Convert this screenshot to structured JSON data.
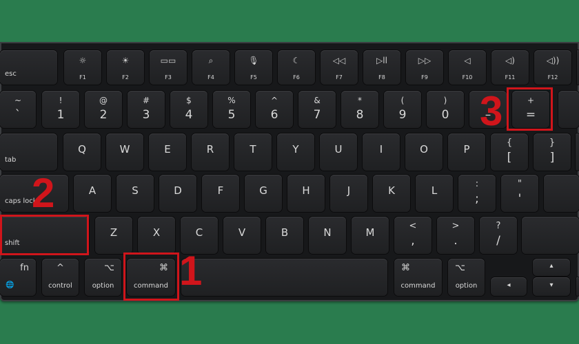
{
  "colors": {
    "background": "#2a7c4e",
    "keyboard": "#17181a",
    "key": "#25262a",
    "annotation": "#d0151b"
  },
  "rows": {
    "function": [
      {
        "main": "esc"
      },
      {
        "icon": "☼",
        "fn": "F1",
        "icon_name": "brightness-down-icon"
      },
      {
        "icon": "☀",
        "fn": "F2",
        "icon_name": "brightness-up-icon"
      },
      {
        "icon": "▭▭",
        "fn": "F3",
        "icon_name": "mission-control-icon"
      },
      {
        "icon": "⌕",
        "fn": "F4",
        "icon_name": "search-icon"
      },
      {
        "icon": "🎙",
        "fn": "F5",
        "icon_name": "microphone-icon"
      },
      {
        "icon": "☾",
        "fn": "F6",
        "icon_name": "moon-icon"
      },
      {
        "icon": "◁◁",
        "fn": "F7",
        "icon_name": "rewind-icon"
      },
      {
        "icon": "▷ll",
        "fn": "F8",
        "icon_name": "play-pause-icon"
      },
      {
        "icon": "▷▷",
        "fn": "F9",
        "icon_name": "fast-forward-icon"
      },
      {
        "icon": "◁",
        "fn": "F10",
        "icon_name": "mute-icon"
      },
      {
        "icon": "◁)",
        "fn": "F11",
        "icon_name": "volume-down-icon"
      },
      {
        "icon": "◁))",
        "fn": "F12",
        "icon_name": "volume-up-icon"
      },
      {
        "icon": "",
        "fn": ""
      }
    ],
    "number": [
      {
        "top": "~",
        "bot": "`"
      },
      {
        "top": "!",
        "bot": "1"
      },
      {
        "top": "@",
        "bot": "2"
      },
      {
        "top": "#",
        "bot": "3"
      },
      {
        "top": "$",
        "bot": "4"
      },
      {
        "top": "%",
        "bot": "5"
      },
      {
        "top": "^",
        "bot": "6"
      },
      {
        "top": "&",
        "bot": "7"
      },
      {
        "top": "*",
        "bot": "8"
      },
      {
        "top": "(",
        "bot": "9"
      },
      {
        "top": ")",
        "bot": "0"
      },
      {
        "top": "",
        "bot": "–"
      },
      {
        "top": "+",
        "bot": "="
      },
      {
        "top": "",
        "bot": ""
      }
    ],
    "tab": [
      {
        "main": "tab"
      },
      {
        "mid": "Q"
      },
      {
        "mid": "W"
      },
      {
        "mid": "E"
      },
      {
        "mid": "R"
      },
      {
        "mid": "T"
      },
      {
        "mid": "Y"
      },
      {
        "mid": "U"
      },
      {
        "mid": "I"
      },
      {
        "mid": "O"
      },
      {
        "mid": "P"
      },
      {
        "top": "{",
        "bot": "["
      },
      {
        "top": "}",
        "bot": "]"
      },
      {
        "mid": ""
      }
    ],
    "caps": [
      {
        "main": "caps lock"
      },
      {
        "mid": "A"
      },
      {
        "mid": "S"
      },
      {
        "mid": "D"
      },
      {
        "mid": "F"
      },
      {
        "mid": "G"
      },
      {
        "mid": "H"
      },
      {
        "mid": "J"
      },
      {
        "mid": "K"
      },
      {
        "mid": "L"
      },
      {
        "top": ":",
        "bot": ";"
      },
      {
        "top": "\"",
        "bot": "'"
      },
      {
        "mid": ""
      }
    ],
    "shift": [
      {
        "main": "shift"
      },
      {
        "mid": "Z"
      },
      {
        "mid": "X"
      },
      {
        "mid": "C"
      },
      {
        "mid": "V"
      },
      {
        "mid": "B"
      },
      {
        "mid": "N"
      },
      {
        "mid": "M"
      },
      {
        "top": "<",
        "bot": ","
      },
      {
        "top": ">",
        "bot": "."
      },
      {
        "top": "?",
        "bot": "/"
      },
      {
        "mid": ""
      }
    ],
    "bottom": [
      {
        "symr": "fn",
        "syml2": "🌐",
        "name": "fn"
      },
      {
        "sym": "^",
        "label": "control"
      },
      {
        "symr": "⌥",
        "label": "option"
      },
      {
        "symr": "⌘",
        "label": "command"
      },
      {
        "label": ""
      },
      {
        "syml": "⌘",
        "label": "command"
      },
      {
        "syml": "⌥",
        "label": "option"
      },
      {
        "arrow": "◂"
      },
      {
        "arrow": "▴"
      },
      {
        "arrow": "▾"
      },
      {
        "arrow": ""
      }
    ]
  },
  "annotations": [
    "1",
    "2",
    "3"
  ]
}
